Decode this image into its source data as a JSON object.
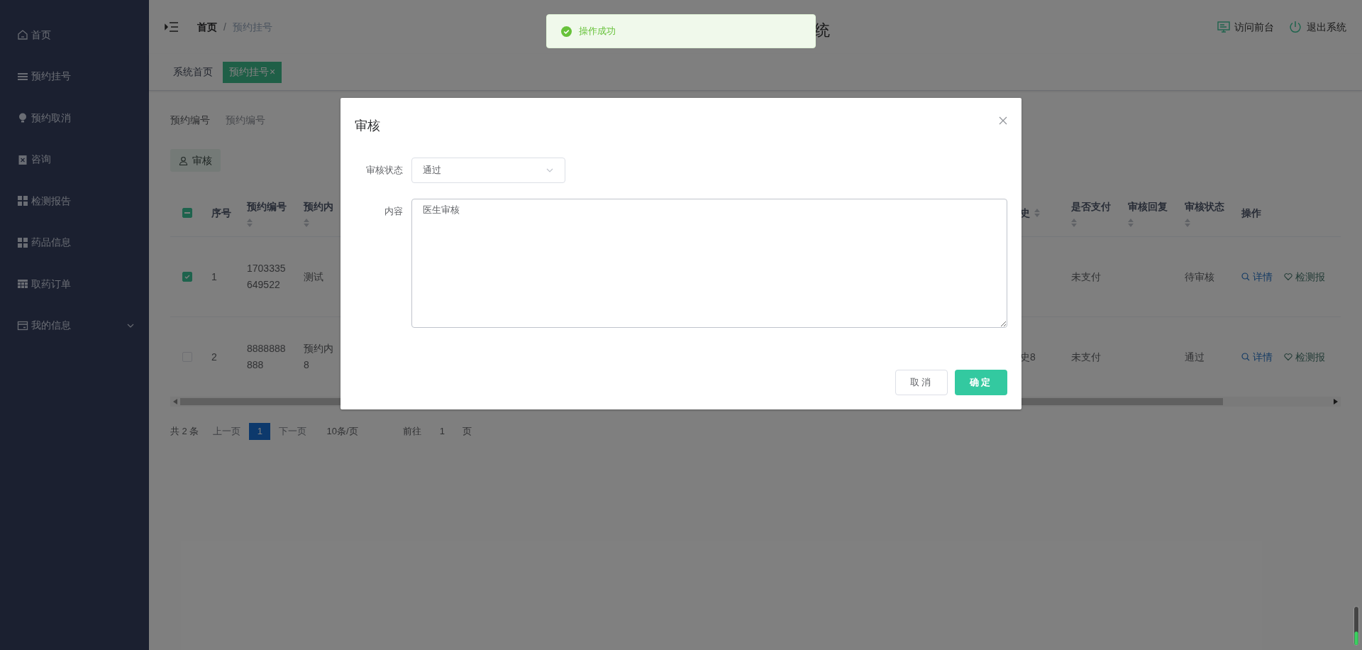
{
  "sidebar": {
    "items": [
      {
        "label": "首页",
        "kind": "home"
      },
      {
        "label": "预约挂号",
        "kind": "list"
      },
      {
        "label": "预约取消",
        "kind": "bulb"
      },
      {
        "label": "咨询",
        "kind": "clipboard"
      },
      {
        "label": "检测报告",
        "kind": "grid"
      },
      {
        "label": "药品信息",
        "kind": "grid"
      },
      {
        "label": "取药订单",
        "kind": "table"
      },
      {
        "label": "我的信息",
        "kind": "card",
        "expandable": true
      }
    ]
  },
  "header": {
    "breadcrumb": [
      "首页",
      "预约挂号"
    ],
    "breadcrumb_separator": "/",
    "title_fragment": "统",
    "links": [
      {
        "label": "访问前台",
        "kind": "monitor"
      },
      {
        "label": "退出系统",
        "kind": "power"
      }
    ]
  },
  "tabs": [
    {
      "label": "系统首页",
      "selected": false
    },
    {
      "label": "预约挂号",
      "selected": true,
      "close": "×"
    }
  ],
  "search": {
    "label": "预约编号",
    "placeholder": "预约编号"
  },
  "toolbar": {
    "button": "审核"
  },
  "table": {
    "header_checkbox": {
      "indeterminate": true
    },
    "left_columns": [
      {
        "label": "序号",
        "sortable": false
      },
      {
        "label": "预约编号",
        "sortable": true
      },
      {
        "label": "预约内",
        "sortable": true
      }
    ],
    "right_columns": [
      {
        "label": "史",
        "sortable": true
      },
      {
        "label": "是否支付",
        "sortable": true
      },
      {
        "label": "审核回复",
        "sortable": true
      },
      {
        "label": "审核状态",
        "sortable": true
      },
      {
        "label": "操作",
        "sortable": false
      }
    ],
    "rows": [
      {
        "checked": true,
        "index": "1",
        "number": "1703335649522",
        "content": [
          "测试"
        ],
        "paid": "未支付",
        "status": "待审核",
        "actions": [
          {
            "label": "详情",
            "kind": "search"
          },
          {
            "label": "检测报",
            "kind": "heart"
          }
        ]
      },
      {
        "checked": false,
        "index": "2",
        "number": "8888888888",
        "content": [
          "预约内",
          "8"
        ],
        "history": "史8",
        "paid": "未支付",
        "status": "通过",
        "actions": [
          {
            "label": "详情",
            "kind": "search"
          },
          {
            "label": "检测报",
            "kind": "heart"
          }
        ]
      }
    ]
  },
  "pagination": {
    "total": "共 2 条",
    "prev": "上一页",
    "pages": [
      {
        "label": "1",
        "selected": true
      }
    ],
    "next": "下一页",
    "page_size": "10条/页",
    "goto_label": "前往",
    "goto_value": "1",
    "goto_suffix": "页"
  },
  "toast": {
    "message": "操作成功"
  },
  "dialog": {
    "title": "审核",
    "fields": [
      {
        "kind": "select",
        "label": "审核状态",
        "value": "通过"
      },
      {
        "kind": "textarea",
        "label": "内容",
        "value": "医生审核"
      }
    ],
    "buttons": [
      {
        "label": "取消",
        "kind": "default"
      },
      {
        "label": "确定",
        "kind": "primary"
      }
    ]
  }
}
